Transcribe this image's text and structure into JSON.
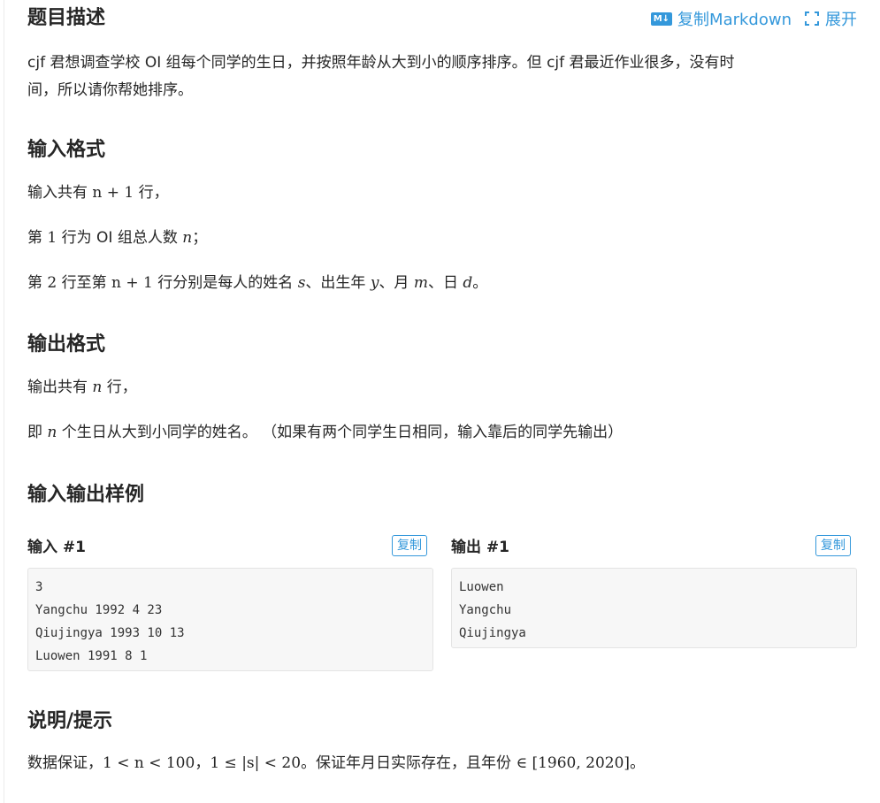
{
  "header": {
    "title": "题目描述",
    "copy_markdown": "复制Markdown",
    "expand": "展开",
    "md_icon_text": "M↓"
  },
  "description": {
    "line1": "cjf 君想调查学校 OI 组每个同学的生日，并按照年龄从大到小的顺序排序。但 cjf 君最近作业很多，没有时",
    "line2": "间，所以请你帮她排序。"
  },
  "input_format": {
    "title": "输入格式",
    "l1_pre": "输入共有 ",
    "l1_math": "n + 1",
    "l1_post": " 行，",
    "l2_pre": "第 ",
    "l2_num": "1",
    "l2_mid": " 行为 OI 组总人数 ",
    "l2_math": "n",
    "l2_post": "；",
    "l3_pre": "第 ",
    "l3_num": "2",
    "l3_mid": " 行至第 ",
    "l3_math": "n + 1",
    "l3_a": " 行分别是每人的姓名 ",
    "l3_s": "s",
    "l3_b": "、出生年 ",
    "l3_y": "y",
    "l3_c": "、月 ",
    "l3_m": "m",
    "l3_d_text": "、日 ",
    "l3_d": "d",
    "l3_end": "。"
  },
  "output_format": {
    "title": "输出格式",
    "l1_pre": "输出共有 ",
    "l1_math": "n",
    "l1_post": " 行，",
    "l2_pre": "即 ",
    "l2_math": "n",
    "l2_post": " 个生日从大到小同学的姓名。 （如果有两个同学生日相同，输入靠后的同学先输出）"
  },
  "samples": {
    "title": "输入输出样例",
    "input_label": "输入 #1",
    "output_label": "输出 #1",
    "copy_label": "复制",
    "input_lines": [
      "3",
      "Yangchu 1992 4 23",
      "Qiujingya 1993 10 13",
      "Luowen 1991 8 1"
    ],
    "output_lines": [
      "Luowen",
      "Yangchu",
      "Qiujingya"
    ]
  },
  "hint": {
    "title": "说明/提示",
    "pre": "数据保证，",
    "m1": "1 < n < 100",
    "sep": "，",
    "m2": "1 ≤ |s| < 20",
    "mid": "。保证年月日实际存在，且年份 ",
    "m3": "∈ [1960, 2020]",
    "end": "。"
  },
  "colors": {
    "accent": "#3498db",
    "text": "#262626",
    "code_bg": "#f7f7f7"
  }
}
